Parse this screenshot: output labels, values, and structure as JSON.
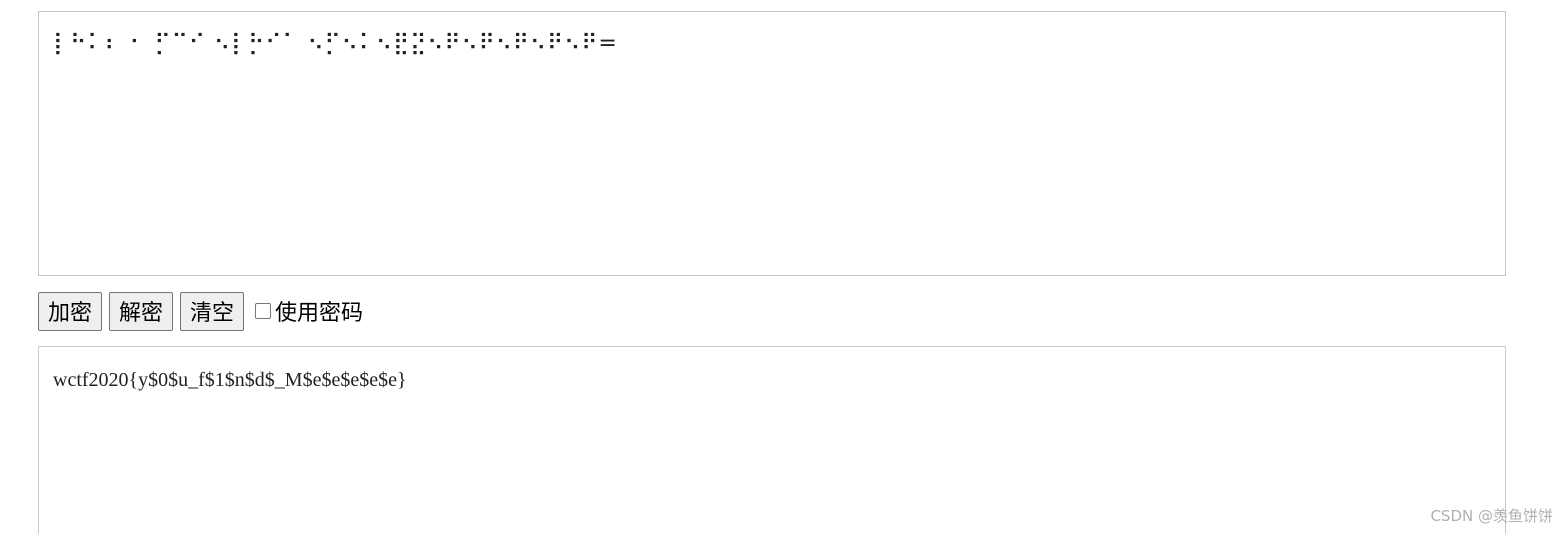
{
  "input": {
    "value": "⡇⠓⠅⠆ ⠂ ⡋⠉⠊ ⠢⡇⡓⠊⠁ ⠢⡋⠢⠅⠢⣟⣝⠢⠟⠢⠟⠢⠟⠢⠟⠢⠟="
  },
  "toolbar": {
    "encrypt_label": "加密",
    "decrypt_label": "解密",
    "clear_label": "清空",
    "use_password_label": "使用密码"
  },
  "output": {
    "value": "wctf2020{y$0$u_f$1$n$d$_M$e$e$e$e$e}"
  },
  "watermark": {
    "text": "CSDN @羡鱼饼饼"
  }
}
